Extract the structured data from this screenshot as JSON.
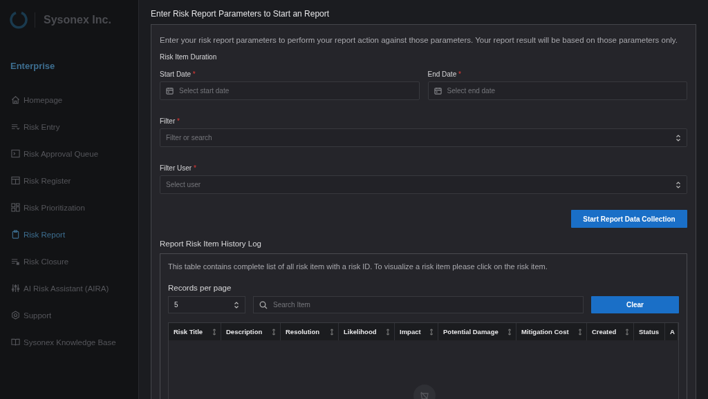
{
  "sidebar": {
    "brand": "Sysonex Inc.",
    "section": "Enterprise",
    "items": [
      {
        "label": "Homepage",
        "selected": false
      },
      {
        "label": "Risk Entry",
        "selected": false
      },
      {
        "label": "Risk Approval Queue",
        "selected": false
      },
      {
        "label": "Risk Register",
        "selected": false
      },
      {
        "label": "Risk Prioritization",
        "selected": false
      },
      {
        "label": "Risk Report",
        "selected": true
      },
      {
        "label": "Risk Closure",
        "selected": false
      },
      {
        "label": "AI Risk Assistant (AIRA)",
        "selected": false
      },
      {
        "label": "Support",
        "selected": false
      },
      {
        "label": "Sysonex Knowledge Base",
        "selected": false
      }
    ]
  },
  "page_title": "Enter Risk Report Parameters to Start an Report",
  "parameters": {
    "intro": "Enter your risk report parameters to perform your report action against those parameters. Your report result will be based on those parameters only.",
    "duration_label": "Risk Item Duration",
    "start_date": {
      "label": "Start Date",
      "required_mark": "*",
      "placeholder": "Select start date"
    },
    "end_date": {
      "label": "End Date",
      "required_mark": "*",
      "placeholder": "Select end date"
    },
    "filter": {
      "label": "Filter",
      "required_mark": "*",
      "placeholder": "Filter or search"
    },
    "filter_user": {
      "label": "Filter User",
      "required_mark": "*",
      "placeholder": "Select user"
    },
    "start_button": "Start Report Data Collection"
  },
  "history": {
    "title": "Report Risk Item History Log",
    "intro": "This table contains complete list of all risk item with a risk ID. To visualize a risk item please click on the risk item.",
    "records_label": "Records per page",
    "records_value": "5",
    "search_placeholder": "Search Item",
    "clear_button": "Clear",
    "columns": [
      {
        "label": "Risk Title",
        "sortable": true
      },
      {
        "label": "Description",
        "sortable": true
      },
      {
        "label": "Resolution",
        "sortable": true
      },
      {
        "label": "Likelihood",
        "sortable": true
      },
      {
        "label": "Impact",
        "sortable": true
      },
      {
        "label": "Potential Damage",
        "sortable": true
      },
      {
        "label": "Mitigation Cost",
        "sortable": true
      },
      {
        "label": "Created",
        "sortable": true
      },
      {
        "label": "Status",
        "sortable": false
      },
      {
        "label": "A"
      }
    ]
  }
}
